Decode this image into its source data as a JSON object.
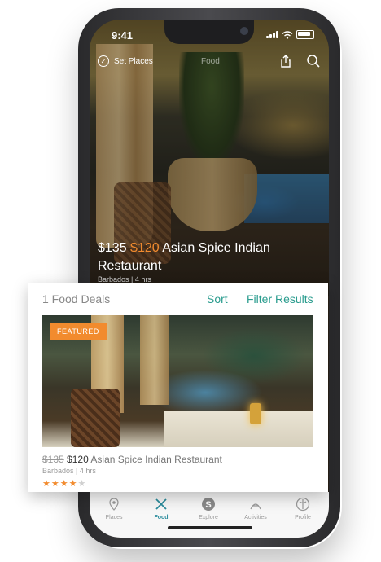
{
  "status_bar": {
    "time": "9:41"
  },
  "top_nav": {
    "set_places": "Set Places",
    "title": "Food"
  },
  "hero": {
    "old_price": "$135",
    "new_price": "$120",
    "title": "Asian Spice Indian Restaurant",
    "location": "Barbados",
    "duration": "4 hrs"
  },
  "deals": {
    "count_label": "1 Food Deals",
    "sort_label": "Sort",
    "filter_label": "Filter Results",
    "card": {
      "badge": "FEATURED",
      "old_price": "$135",
      "new_price": "$120",
      "name": "Asian Spice Indian Restaurant",
      "location": "Barbados",
      "duration": "4 hrs",
      "rating": 4,
      "rating_max": 5
    }
  },
  "tabs": [
    {
      "label": "Places",
      "icon": "pin-icon"
    },
    {
      "label": "Food",
      "icon": "utensils-icon",
      "active": true
    },
    {
      "label": "Explore",
      "icon": "explore-icon"
    },
    {
      "label": "Activities",
      "icon": "activities-icon"
    },
    {
      "label": "Profile",
      "icon": "profile-icon"
    }
  ],
  "colors": {
    "accent": "#2a9c8e",
    "price": "#f28b2e",
    "badge": "#f28b2e"
  }
}
